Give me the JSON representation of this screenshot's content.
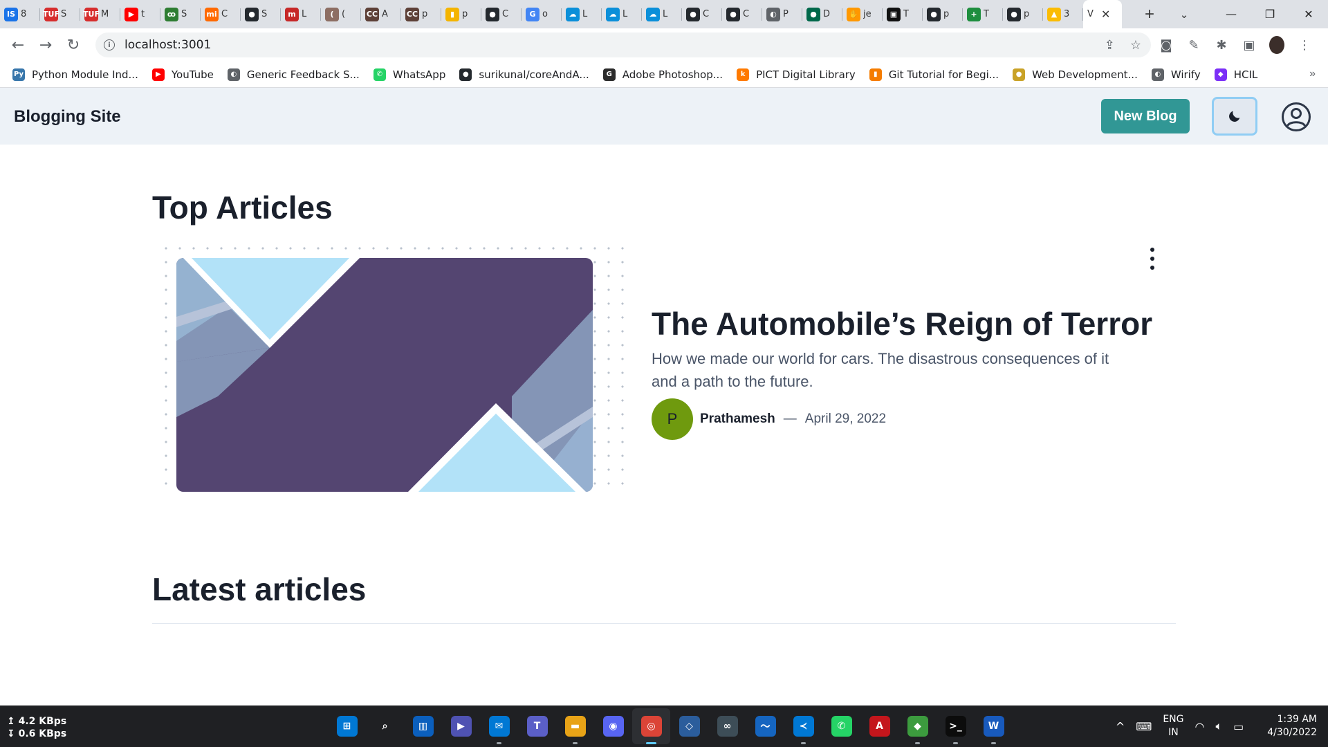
{
  "browser": {
    "tabs": [
      {
        "title": "8",
        "icon": "IS",
        "color": "#1a73e8",
        "icon_name": "is-icon"
      },
      {
        "title": "S",
        "icon": "TUF",
        "color": "#d62d2d",
        "icon_name": "tuf-icon"
      },
      {
        "title": "M",
        "icon": "TUF",
        "color": "#d62d2d",
        "icon_name": "tuf-icon"
      },
      {
        "title": "t",
        "icon": "▶",
        "color": "#ff0000",
        "icon_name": "youtube-icon"
      },
      {
        "title": "S",
        "icon": "ꝏ",
        "color": "#2e7d32",
        "icon_name": "gfg-icon"
      },
      {
        "title": "C",
        "icon": "mi",
        "color": "#ff6900",
        "icon_name": "mi-icon"
      },
      {
        "title": "S",
        "icon": "●",
        "color": "#24292e",
        "icon_name": "github-icon"
      },
      {
        "title": "L",
        "icon": "m",
        "color": "#c62828",
        "icon_name": "m-icon"
      },
      {
        "title": "(",
        "icon": "(",
        "color": "#8d6e63",
        "icon_name": "c-icon"
      },
      {
        "title": "A",
        "icon": "CC",
        "color": "#5d4037",
        "icon_name": "codechef-icon"
      },
      {
        "title": "p",
        "icon": "CC",
        "color": "#5d4037",
        "icon_name": "codechef-icon"
      },
      {
        "title": "p",
        "icon": "▮",
        "color": "#f4b400",
        "icon_name": "chart-icon"
      },
      {
        "title": "C",
        "icon": "●",
        "color": "#24292e",
        "icon_name": "github-icon"
      },
      {
        "title": "o",
        "icon": "G",
        "color": "#4285f4",
        "icon_name": "google-icon"
      },
      {
        "title": "L",
        "icon": "☁",
        "color": "#0b8fd9",
        "icon_name": "cloud-icon"
      },
      {
        "title": "L",
        "icon": "☁",
        "color": "#0b8fd9",
        "icon_name": "cloud-icon"
      },
      {
        "title": "L",
        "icon": "☁",
        "color": "#0b8fd9",
        "icon_name": "cloud-icon"
      },
      {
        "title": "C",
        "icon": "●",
        "color": "#24292e",
        "icon_name": "github-icon"
      },
      {
        "title": "C",
        "icon": "●",
        "color": "#24292e",
        "icon_name": "github-icon"
      },
      {
        "title": "P",
        "icon": "◐",
        "color": "#5f6368",
        "icon_name": "globe-icon"
      },
      {
        "title": "D",
        "icon": "●",
        "color": "#00684a",
        "icon_name": "mongodb-icon"
      },
      {
        "title": "je",
        "icon": "✋",
        "color": "#ff9800",
        "icon_name": "hand-icon"
      },
      {
        "title": "T",
        "icon": "▣",
        "color": "#111111",
        "icon_name": "t-icon"
      },
      {
        "title": "p",
        "icon": "●",
        "color": "#24292e",
        "icon_name": "github-icon"
      },
      {
        "title": "T",
        "icon": "+",
        "color": "#1e8e3e",
        "icon_name": "plus-icon"
      },
      {
        "title": "p",
        "icon": "●",
        "color": "#24292e",
        "icon_name": "github-icon"
      },
      {
        "title": "3",
        "icon": "▲",
        "color": "#fbbc04",
        "icon_name": "drive-icon"
      }
    ],
    "active_tab": {
      "title": "V"
    },
    "url": "localhost:3001",
    "bookmarks": [
      {
        "label": "Python Module Ind...",
        "icon": "Py",
        "color": "#3776ab",
        "icon_name": "python-icon"
      },
      {
        "label": "YouTube",
        "icon": "▶",
        "color": "#ff0000",
        "icon_name": "youtube-icon"
      },
      {
        "label": "Generic Feedback S...",
        "icon": "◐",
        "color": "#5f6368",
        "icon_name": "globe-icon"
      },
      {
        "label": "WhatsApp",
        "icon": "✆",
        "color": "#25d366",
        "icon_name": "whatsapp-icon"
      },
      {
        "label": "surikunal/coreAndA...",
        "icon": "●",
        "color": "#24292e",
        "icon_name": "github-icon"
      },
      {
        "label": "Adobe Photoshop...",
        "icon": "G",
        "color": "#2b2b2b",
        "icon_name": "g-icon"
      },
      {
        "label": "PICT Digital Library",
        "icon": "k",
        "color": "#ff7a00",
        "icon_name": "k-icon"
      },
      {
        "label": "Git Tutorial for Begi...",
        "icon": "▮",
        "color": "#f57c00",
        "icon_name": "bookmark-icon"
      },
      {
        "label": "Web Development...",
        "icon": "●",
        "color": "#c9a227",
        "icon_name": "web-icon"
      },
      {
        "label": "Wirify",
        "icon": "◐",
        "color": "#5f6368",
        "icon_name": "globe-icon"
      },
      {
        "label": "HCIL",
        "icon": "◆",
        "color": "#7b2ff7",
        "icon_name": "hcil-icon"
      }
    ]
  },
  "site": {
    "title": "Blogging Site",
    "new_blog_label": "New Blog"
  },
  "main": {
    "top_heading": "Top Articles",
    "latest_heading": "Latest articles",
    "featured": {
      "title": "The Automobile’s Reign of Terror",
      "description": "How we made our world for cars. The disastrous consequences of it and a path to the future.",
      "author_initial": "P",
      "author": "Prathamesh",
      "separator": "—",
      "date": "April 29, 2022"
    }
  },
  "taskbar": {
    "upload": "↥ 4.2 KBps",
    "download": "↧ 0.6 KBps",
    "apps": [
      {
        "name": "start-icon",
        "icon": "⊞",
        "color": "#0078d4"
      },
      {
        "name": "search-icon",
        "icon": "⌕",
        "color": "transparent"
      },
      {
        "name": "task-view-icon",
        "icon": "▥",
        "color": "#0b5fbd"
      },
      {
        "name": "meet-icon",
        "icon": "▶",
        "color": "#4f52b2"
      },
      {
        "name": "mail-icon",
        "icon": "✉",
        "color": "#0078d4"
      },
      {
        "name": "teams-icon",
        "icon": "T",
        "color": "#5b5fc7"
      },
      {
        "name": "file-explorer-icon",
        "icon": "▬",
        "color": "#e8a317"
      },
      {
        "name": "discord-icon",
        "icon": "◉",
        "color": "#5865f2"
      },
      {
        "name": "chrome-icon",
        "icon": "◎",
        "color": "#db4437"
      },
      {
        "name": "virtualbox-icon",
        "icon": "◇",
        "color": "#2b5d9c"
      },
      {
        "name": "arduino-icon",
        "icon": "∞",
        "color": "#3d4d57"
      },
      {
        "name": "whiteboard-icon",
        "icon": "〜",
        "color": "#1565c0"
      },
      {
        "name": "vscode-icon",
        "icon": "≺",
        "color": "#0078d4"
      },
      {
        "name": "whatsapp-icon",
        "icon": "✆",
        "color": "#25d366"
      },
      {
        "name": "acrobat-icon",
        "icon": "A",
        "color": "#c4161c"
      },
      {
        "name": "git-icon",
        "icon": "◆",
        "color": "#3c9b3e"
      },
      {
        "name": "terminal-icon",
        "icon": ">_",
        "color": "#0c0c0c"
      },
      {
        "name": "word-icon",
        "icon": "W",
        "color": "#185abd"
      }
    ],
    "active_app_index": 8,
    "running_app_indices": [
      4,
      6,
      8,
      12,
      15,
      16,
      17
    ],
    "lang_top": "ENG",
    "lang_bottom": "IN",
    "time": "1:39 AM",
    "date": "4/30/2022"
  }
}
